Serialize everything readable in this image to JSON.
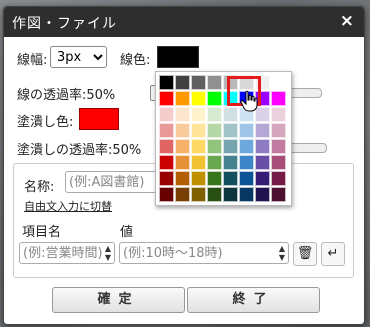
{
  "dialog": {
    "title": "作図・ファイル",
    "close_label": "×"
  },
  "line": {
    "width_label": "線幅:",
    "width_value": "3px",
    "color_label": "線色:",
    "color_value": "#000000",
    "opacity_label": "線の透過率:50%"
  },
  "fill": {
    "color_label": "塗潰し色:",
    "color_value": "#ff0000",
    "opacity_label": "塗潰しの透過率:50%"
  },
  "opacity_levels": {
    "line": 0.5,
    "fill": 0.5
  },
  "palette": {
    "colors": [
      [
        "#000000",
        "#404040",
        "#606060",
        "#909090",
        "#b8b8b8",
        "#d8d8d8",
        "#f0f0f0",
        "#ffffff"
      ],
      [
        "#ff0000",
        "#ff9900",
        "#ffff00",
        "#00ff00",
        "#00ffff",
        "#0000ff",
        "#9900ff",
        "#ff00ff"
      ],
      [
        "#f4cccc",
        "#fce5cd",
        "#fff2cc",
        "#d9ead3",
        "#d0e0e3",
        "#cfe2f3",
        "#d9d2e9",
        "#ead1dc"
      ],
      [
        "#ea9999",
        "#f9cb9c",
        "#ffe599",
        "#b6d7a8",
        "#a2c4c9",
        "#9fc5e8",
        "#b4a7d6",
        "#d5a6bd"
      ],
      [
        "#e06666",
        "#f6b26b",
        "#ffd966",
        "#93c47d",
        "#76a5af",
        "#6fa8dc",
        "#8e7cc3",
        "#c27ba0"
      ],
      [
        "#cc0000",
        "#e69138",
        "#f1c232",
        "#6aa84f",
        "#45818e",
        "#3d85c6",
        "#674ea7",
        "#a64d79"
      ],
      [
        "#990000",
        "#b45f06",
        "#bf9000",
        "#38761d",
        "#134f5c",
        "#0b5394",
        "#351c75",
        "#741b47"
      ],
      [
        "#660000",
        "#783f04",
        "#7f6000",
        "#274e13",
        "#0c343d",
        "#073763",
        "#20124d",
        "#4c1130"
      ]
    ],
    "selected": "#0000ff"
  },
  "attributes": {
    "name_label": "名称:",
    "name_placeholder": "(例:A図書館)",
    "free_input_link": "自由文入力に切替",
    "item_header": "項目名",
    "value_header": "値",
    "item_placeholder": "(例:営業時間)",
    "value_placeholder": "(例:10時～18時)"
  },
  "icons": {
    "trash": "🗑",
    "enter": "↵",
    "spin_up": "▲",
    "spin_down": "▼"
  },
  "footer": {
    "confirm_label": "確定",
    "close_label": "終了"
  }
}
